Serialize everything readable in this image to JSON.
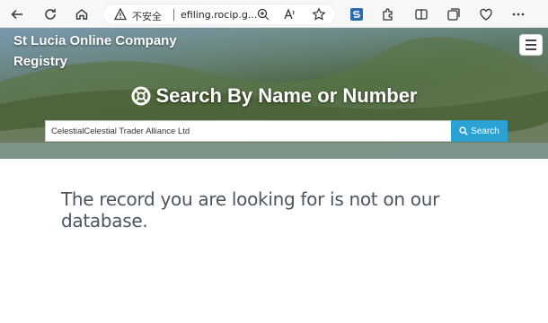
{
  "browser": {
    "security_label": "不安全",
    "url": "efiling.rocip.g..."
  },
  "site": {
    "brand_line1": "St Lucia Online Company",
    "brand_line2": "Registry",
    "hero_title": "Search By Name or Number"
  },
  "search": {
    "value": "CelestialCelestial Trader Alliance Ltd",
    "button_label": "Search"
  },
  "result": {
    "message": "The record you are looking for is not on our database."
  },
  "colors": {
    "search_button": "#2aa3d4",
    "message_text": "#4a5560"
  }
}
